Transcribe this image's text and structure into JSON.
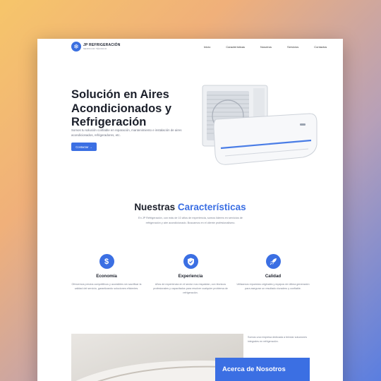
{
  "header": {
    "logo_name": "JP REFRIGERACIÓN",
    "logo_sub": "SERVICIO TÉCNICO",
    "nav": [
      "Inicio",
      "Características",
      "Nosotros",
      "Servicios",
      "Contactos"
    ]
  },
  "hero": {
    "title": "Solución en Aires Acondicionados y Refrigeración",
    "description": "Somos tu solución confiable en reparación, mantenimiento e instalación de aires acondicionados, refrigeradores, etc.",
    "button": "Contactar →"
  },
  "features_section": {
    "title_plain": "Nuestras ",
    "title_accent": "Características",
    "description": "En JP Refrigeración, con más de 10 años de experiencia, somos líderes en servicios de refrigeración y aire acondicionado. Buscamos en el cliente profesionalismo.",
    "items": [
      {
        "icon": "dollar-icon",
        "title": "Economía",
        "text": "Ofrecemos precios competitivos y accesibles sin sacrificar la calidad del servicio, garantizando soluciones eficientes."
      },
      {
        "icon": "shield-icon",
        "title": "Experiencia",
        "text": "Años de experiencia en el sector nos respaldan, con técnicos profesionales y capacitados para resolver cualquier problema de refrigeración."
      },
      {
        "icon": "rocket-icon",
        "title": "Calidad",
        "text": "Utilizamos repuestos originales y equipos de última generación para asegurar un resultado duradero y confiable."
      }
    ]
  },
  "about": {
    "title": "Acerca de Nosotros",
    "text": "Somos una empresa dedicada a brindar soluciones integrales en refrigeración."
  },
  "colors": {
    "accent": "#3b6fe3",
    "dark": "#1b1f2a"
  }
}
